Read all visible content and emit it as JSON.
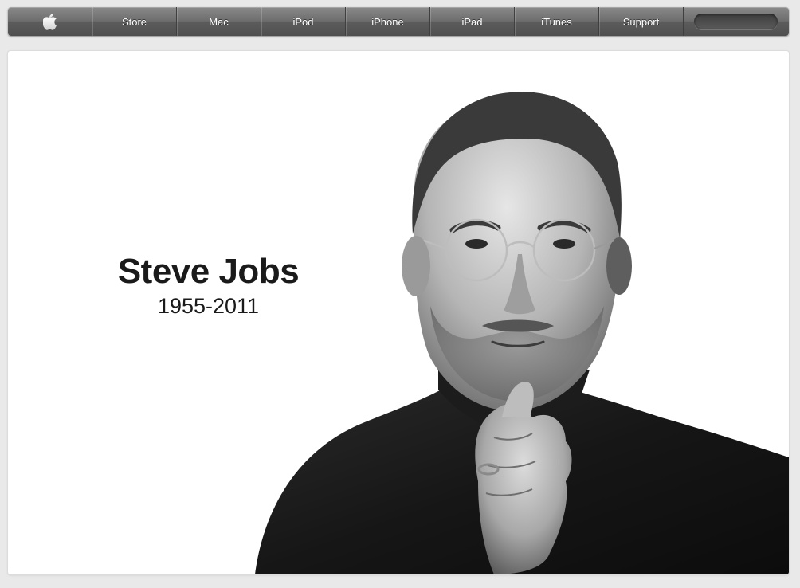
{
  "nav": {
    "apple_icon": "apple-logo-icon",
    "items": [
      {
        "label": "Store"
      },
      {
        "label": "Mac"
      },
      {
        "label": "iPod"
      },
      {
        "label": "iPhone"
      },
      {
        "label": "iPad"
      },
      {
        "label": "iTunes"
      },
      {
        "label": "Support"
      }
    ],
    "search": {
      "value": "",
      "icon": "magnifier-icon"
    }
  },
  "hero": {
    "name": "Steve Jobs",
    "years": "1955-2011",
    "portrait": "black-and-white-portrait"
  },
  "colors": {
    "nav_top": "#8a8a8a",
    "nav_bottom": "#4f4f4f",
    "page_background": "#e9e9e9",
    "content_background": "#ffffff",
    "text": "#1a1a1a"
  }
}
